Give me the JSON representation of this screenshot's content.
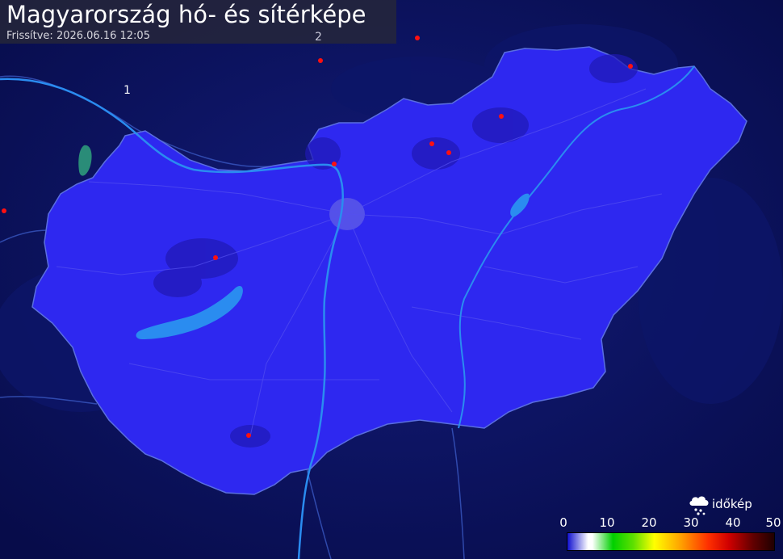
{
  "header": {
    "title": "Magyarország hó- és sítérképe",
    "updated": "Frissítve: 2026.06.16 12:05"
  },
  "map": {
    "region_labels": [
      "1",
      "2"
    ],
    "colors": {
      "background": "#0a1260",
      "country_fill": "#2e28f0",
      "water": "#2a8cf0",
      "marker": "#ff1010"
    }
  },
  "legend": {
    "ticks": [
      "0",
      "10",
      "20",
      "30",
      "40",
      "50"
    ]
  },
  "logo": {
    "text": "időkép",
    "icon": "cloud-snow-icon"
  }
}
